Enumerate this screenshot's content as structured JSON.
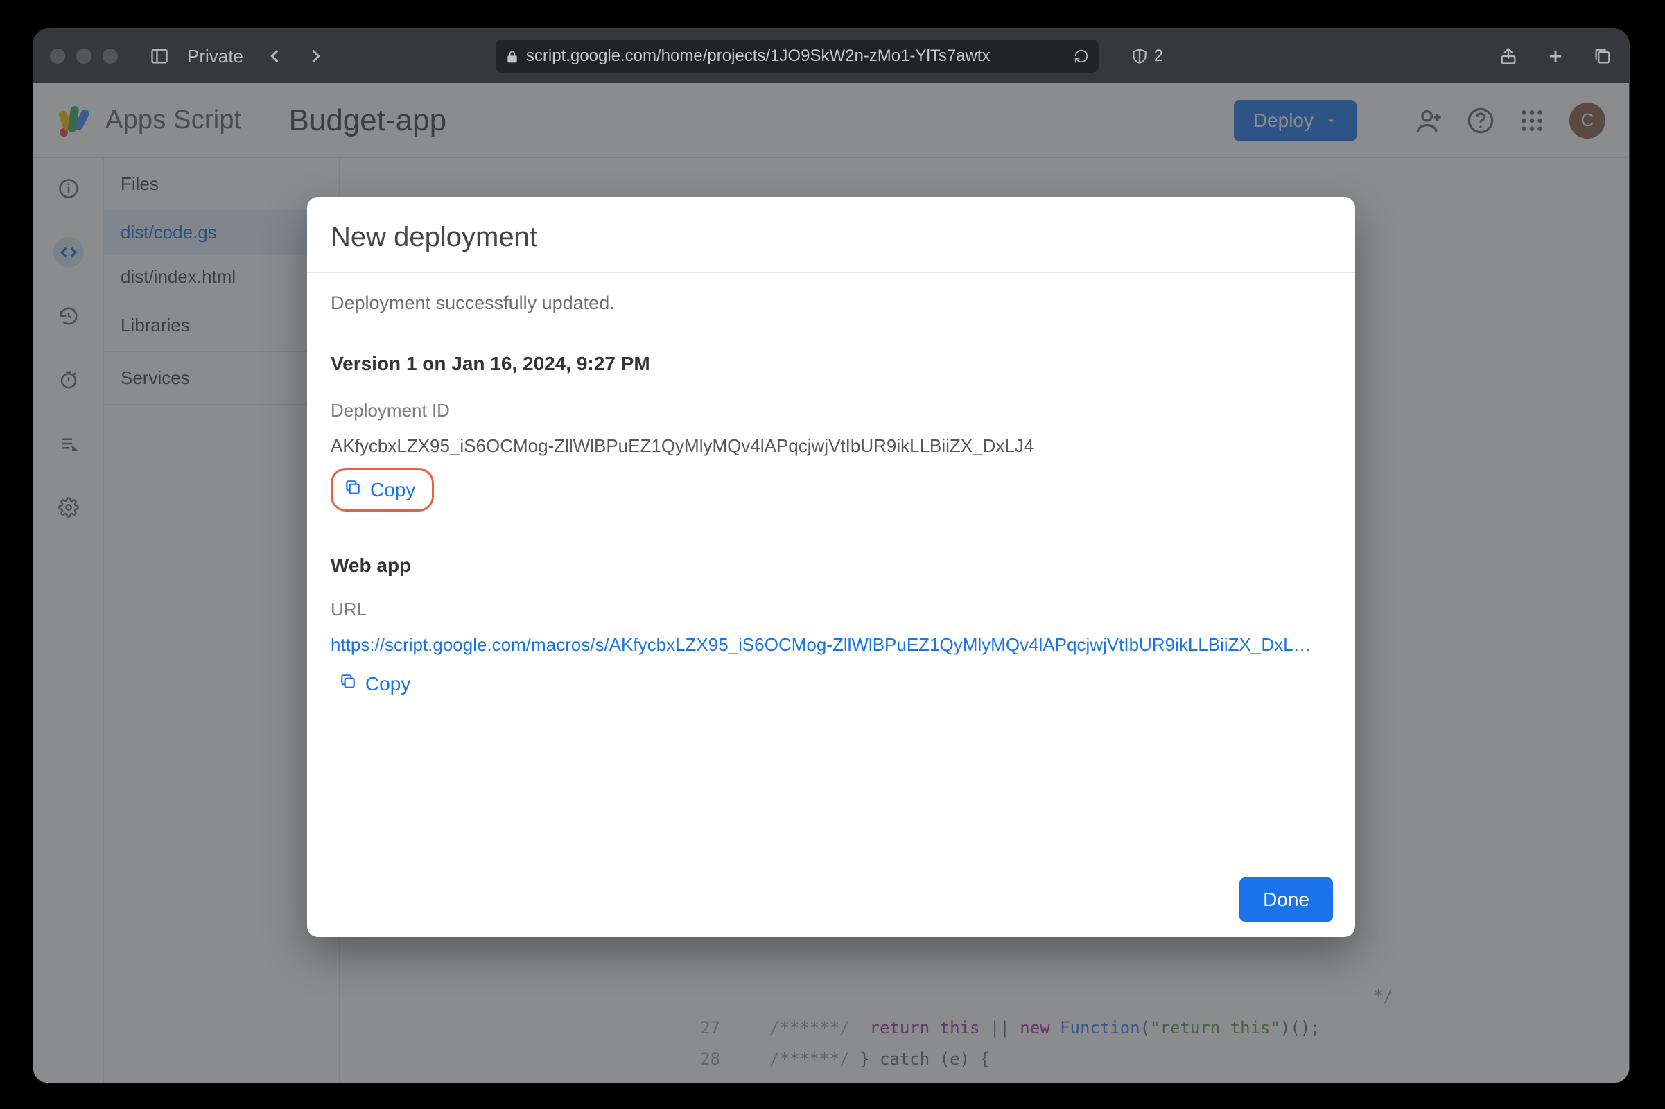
{
  "browser": {
    "private_label": "Private",
    "url": "script.google.com/home/projects/1JO9SkW2n-zMo1-YlTs7awtx",
    "shield_badge": "2"
  },
  "header": {
    "app_name": "Apps Script",
    "project_name": "Budget-app",
    "deploy_label": "Deploy",
    "avatar_initial": "C"
  },
  "sidebar": {
    "files_header": "Files",
    "items": [
      {
        "label": "dist/code.gs",
        "active": true
      },
      {
        "label": "dist/index.html",
        "active": false
      }
    ],
    "libraries_header": "Libraries",
    "services_header": "Services"
  },
  "code": {
    "visible_line_nums": [
      "27",
      "28"
    ],
    "line_trailing_comment": "*/",
    "line27_prefix": "/******/",
    "line27_kw1": "return",
    "line27_kw2": "this",
    "line27_op": " || ",
    "line27_kw3": "new",
    "line27_fn": "Function",
    "line27_str": "\"return this\"",
    "line27_tail": ")();",
    "line28_prefix": "/******/",
    "line28_text": "      } catch (e) {"
  },
  "dialog": {
    "title": "New deployment",
    "message": "Deployment successfully updated.",
    "version_line": "Version 1 on Jan 16, 2024, 9:27 PM",
    "deployment_id_label": "Deployment ID",
    "deployment_id": "AKfycbxLZX95_iS6OCMog-ZllWlBPuEZ1QyMlyMQv4lAPqcjwjVtIbUR9ikLLBiiZX_DxLJ4",
    "copy_label": "Copy",
    "webapp_title": "Web app",
    "url_label": "URL",
    "url_value": "https://script.google.com/macros/s/AKfycbxLZX95_iS6OCMog-ZllWlBPuEZ1QyMlyMQv4lAPqcjwjVtIbUR9ikLLBiiZX_DxL…",
    "done_label": "Done"
  }
}
